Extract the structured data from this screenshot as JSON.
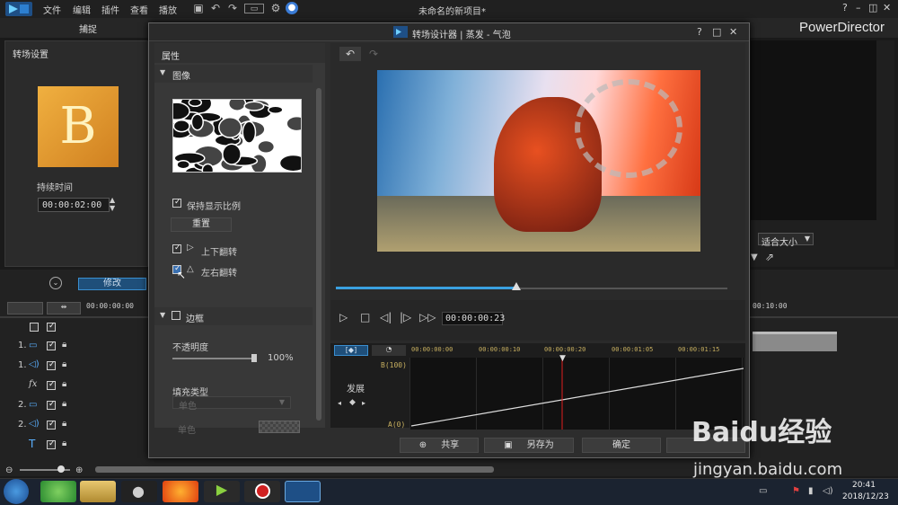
{
  "app": {
    "menu": [
      "文件",
      "编辑",
      "插件",
      "查看",
      "播放"
    ],
    "window_title": "未命名的新项目*",
    "brand": "PowerDirector",
    "win_controls": [
      "?",
      "–",
      "◫",
      "✕"
    ]
  },
  "tabs": {
    "capture": "捕捉"
  },
  "left_panel": {
    "title": "转场设置",
    "thumb_letter": "B",
    "duration_label": "持续时间",
    "duration_value": "00:00:02:00"
  },
  "right_panel": {
    "fit_label": "适合大小"
  },
  "timeline": {
    "modify_label": "修改",
    "ruler_start": "00:00:00:00",
    "ruler_right": "00:10:00",
    "tracks": [
      {
        "num": "",
        "type": "all"
      },
      {
        "num": "1.",
        "type": "video"
      },
      {
        "num": "1.",
        "type": "audio"
      },
      {
        "num": "",
        "type": "fx"
      },
      {
        "num": "2.",
        "type": "video"
      },
      {
        "num": "2.",
        "type": "audio"
      },
      {
        "num": "",
        "type": "title"
      }
    ]
  },
  "dialog": {
    "title": "转场设计器 | 蒸发 - 气泡",
    "controls": [
      "?",
      "□",
      "✕"
    ],
    "props_header": "属性",
    "image_section": "图像",
    "keep_ratio": "保持显示比例",
    "reset": "重置",
    "flip_v": "上下翻转",
    "flip_h": "左右翻转",
    "border_section": "边框",
    "opacity_label": "不透明度",
    "opacity_value": "100%",
    "fill_type_label": "填充类型",
    "fill_type_value": "单色",
    "color_label": "单色",
    "timecode": "00:00:00:23",
    "kf_ruler": [
      "00:00:00:00",
      "00:00:00:10",
      "00:00:00:20",
      "00:00:01:05",
      "00:00:01:15"
    ],
    "kf_top": "B(100)",
    "kf_bottom": "A(0)",
    "kf_label": "发展",
    "buttons": {
      "share": "共享",
      "save_as": "另存为",
      "ok": "确定"
    }
  },
  "taskbar": {
    "time": "20:41",
    "date": "2018/12/23"
  },
  "watermark": {
    "brand": "Baidu经验",
    "url": "jingyan.baidu.com"
  },
  "colors": {
    "accent": "#3aa0e0",
    "playhead": "#e02020",
    "brand_thumb": "#e8a030"
  }
}
